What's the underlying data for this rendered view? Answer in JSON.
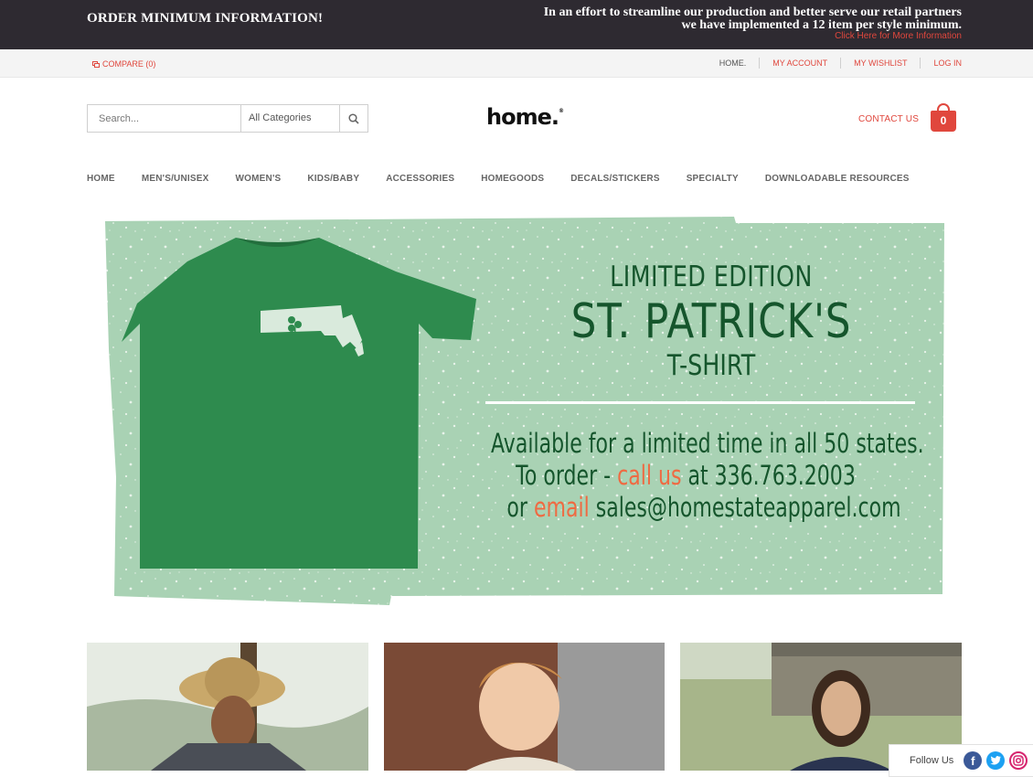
{
  "announcement": {
    "title": "ORDER MINIMUM INFORMATION!",
    "message": "In an effort to streamline our production and better serve our retail partners we have implemented a 12 item per style minimum.",
    "link": "Click Here for More Information"
  },
  "utility": {
    "compare": "COMPARE (0)",
    "links": [
      "HOME.",
      "MY ACCOUNT",
      "MY WISHLIST",
      "LOG IN"
    ]
  },
  "header": {
    "search_placeholder": "Search...",
    "category_select": "All Categories",
    "logo": "home",
    "contact": "CONTACT US",
    "cart_count": "0"
  },
  "nav": [
    "HOME",
    "MEN'S/UNISEX",
    "WOMEN'S",
    "KIDS/BABY",
    "ACCESSORIES",
    "HOMEGOODS",
    "DECALS/STICKERS",
    "SPECIALTY",
    "DOWNLOADABLE RESOURCES"
  ],
  "hero": {
    "line1": "LIMITED EDITION",
    "line2": "ST. PATRICK'S",
    "line3": "T-SHIRT",
    "body1": "Available for a limited time in all 50 states.",
    "body2_pre": "To order - ",
    "body2_accent": "call us",
    "body2_post": " at 336.763.2003",
    "body3_pre": "or ",
    "body3_accent": "email",
    "body3_post": " sales@homestateapparel.com",
    "colors": {
      "banner": "#a9d2b4",
      "shirt": "#2e8b4e",
      "text": "#15552c",
      "accent": "#ef6a42"
    }
  },
  "follow": {
    "label": "Follow Us",
    "icons": [
      "facebook-icon",
      "twitter-icon",
      "instagram-icon"
    ]
  },
  "colors": {
    "accent": "#e0473d",
    "topbar": "#2e2a31"
  }
}
